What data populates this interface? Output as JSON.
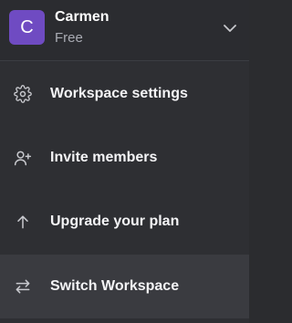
{
  "account": {
    "avatar_initial": "C",
    "name": "Carmen",
    "plan": "Free"
  },
  "menu": {
    "items": [
      {
        "label": "Workspace settings",
        "icon": "gear-icon"
      },
      {
        "label": "Invite members",
        "icon": "user-plus-icon"
      },
      {
        "label": "Upgrade your plan",
        "icon": "arrow-up-icon"
      },
      {
        "label": "Switch Workspace",
        "icon": "swap-arrows-icon"
      }
    ]
  },
  "colors": {
    "avatar_bg": "#6f4bc2",
    "panel_bg": "#2e2f33",
    "active_item_bg": "#3a3b40"
  }
}
